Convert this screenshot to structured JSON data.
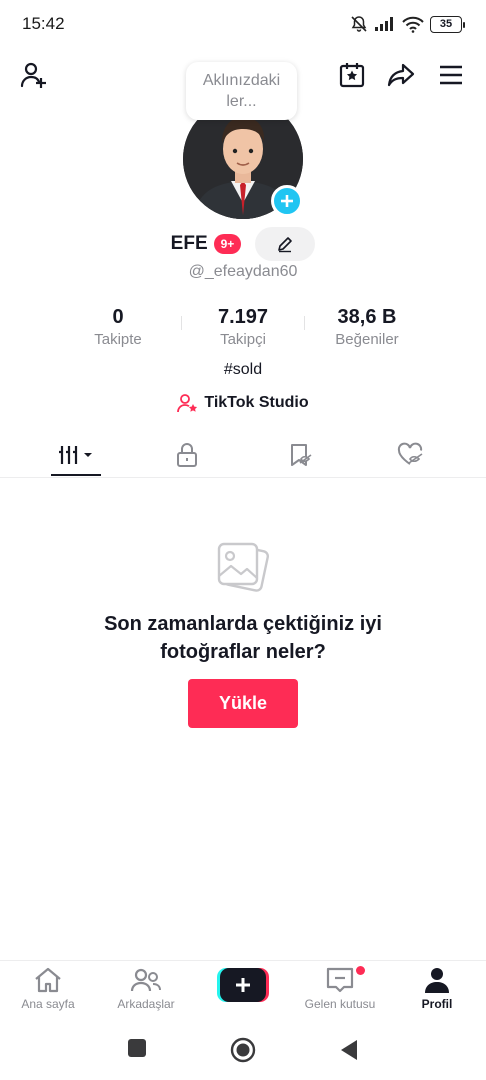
{
  "status_bar": {
    "time": "15:42",
    "battery": "35"
  },
  "bubble": {
    "text": "Aklınızdaki ler..."
  },
  "profile": {
    "username": "EFE",
    "badge": "9+",
    "handle": "@_efeaydan60",
    "bio": "#sold",
    "studio_link": "TikTok Studio"
  },
  "stats": [
    {
      "value": "0",
      "label": "Takipte"
    },
    {
      "value": "7.197",
      "label": "Takipçi"
    },
    {
      "value": "38,6 B",
      "label": "Beğeniler"
    }
  ],
  "empty_state": {
    "title": "Son zamanlarda çektiğiniz iyi fotoğraflar neler?",
    "button": "Yükle"
  },
  "bottom_nav": [
    {
      "label": "Ana sayfa",
      "icon": "home-icon"
    },
    {
      "label": "Arkadaşlar",
      "icon": "friends-icon"
    },
    {
      "label": "",
      "icon": "plus-icon"
    },
    {
      "label": "Gelen kutusu",
      "icon": "inbox-icon"
    },
    {
      "label": "Profil",
      "icon": "profile-icon"
    }
  ],
  "colors": {
    "accent": "#fe2c55",
    "cyan": "#20c5f2",
    "text": "#161823",
    "muted": "#8a8b91"
  }
}
